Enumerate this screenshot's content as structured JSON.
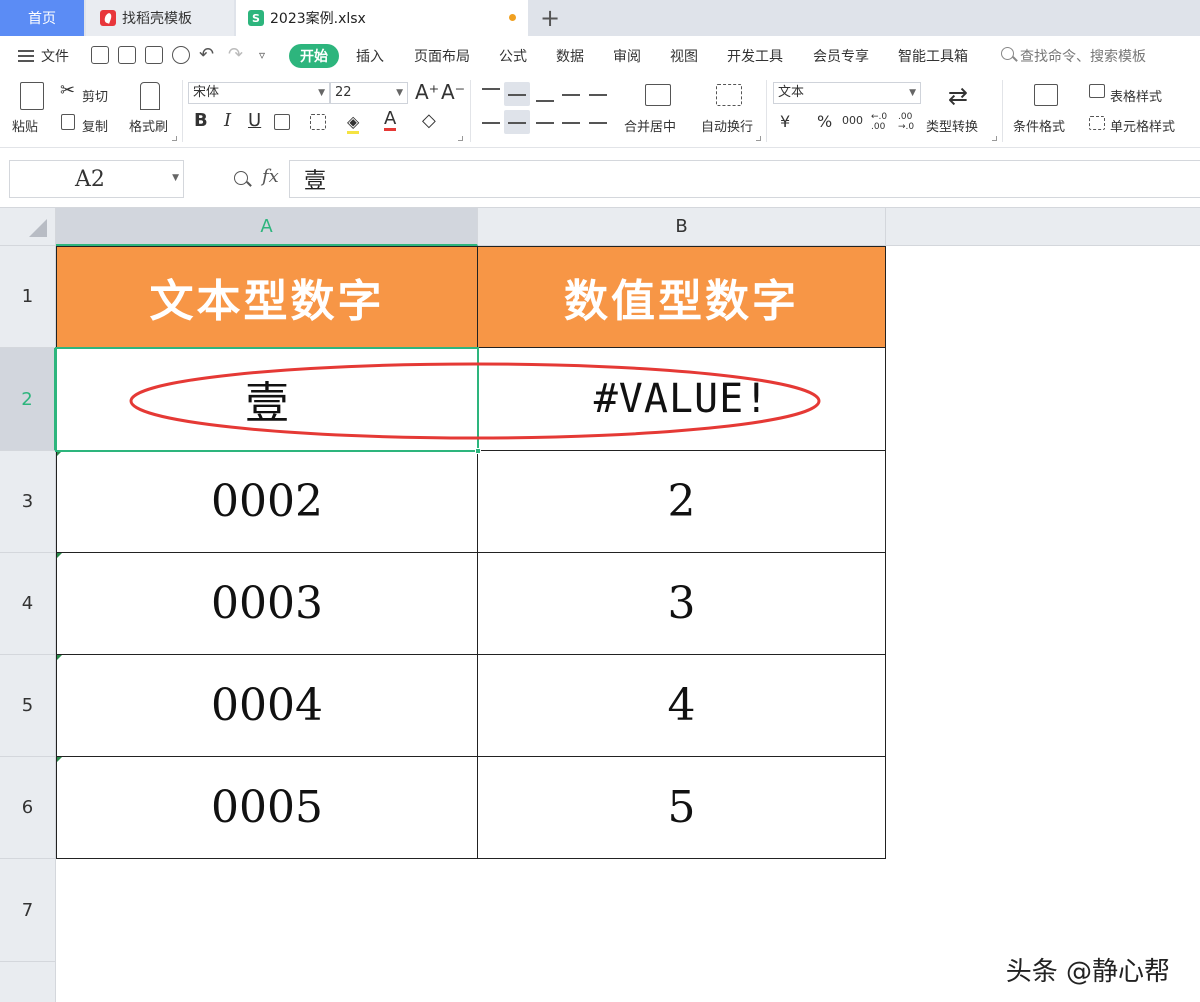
{
  "tabs": {
    "home": "首页",
    "template": "找稻壳模板",
    "file": "2023案例.xlsx",
    "new_tab": "+"
  },
  "menu": {
    "file": "文件",
    "start": "开始",
    "insert": "插入",
    "page_layout": "页面布局",
    "formula": "公式",
    "data": "数据",
    "review": "审阅",
    "view": "视图",
    "dev_tools": "开发工具",
    "member": "会员专享",
    "smart_tools": "智能工具箱",
    "search_placeholder": "查找命令、搜索模板"
  },
  "ribbon": {
    "paste": "粘贴",
    "cut": "剪切",
    "copy": "复制",
    "format_painter": "格式刷",
    "font_name": "宋体",
    "font_size": "22",
    "bold": "B",
    "italic": "I",
    "underline": "U",
    "font_color_glyph": "A",
    "merge_center": "合并居中",
    "wrap_text": "自动换行",
    "number_format": "文本",
    "currency": "¥",
    "percent": "%",
    "thousands": "000",
    "dec_inc": "←.0 .00",
    "dec_dec": ".00 →.0",
    "type_convert": "类型转换",
    "cond_format": "条件格式",
    "table_style": "表格样式",
    "cell_style": "单元格样式"
  },
  "formula_bar": {
    "name_box": "A2",
    "fx": "fx",
    "value": "壹"
  },
  "sheet": {
    "columns": [
      "A",
      "B"
    ],
    "rows": [
      "1",
      "2",
      "3",
      "4",
      "5",
      "6",
      "7"
    ],
    "header": [
      "文本型数字",
      "数值型数字"
    ],
    "data": [
      [
        "壹",
        "#VALUE!"
      ],
      [
        "0002",
        "2"
      ],
      [
        "0003",
        "3"
      ],
      [
        "0004",
        "4"
      ],
      [
        "0005",
        "5"
      ]
    ],
    "active_cell": "A2"
  },
  "colors": {
    "header_fill": "#f79646",
    "accent": "#2db57d",
    "annotation": "#e53935",
    "home_tab": "#5b8cf5"
  },
  "watermark": "头条 @静心帮"
}
